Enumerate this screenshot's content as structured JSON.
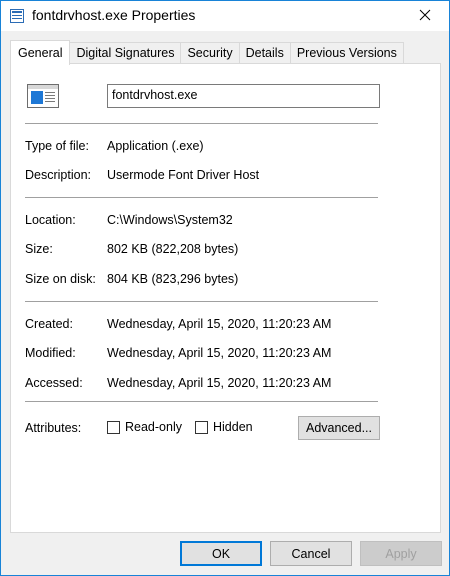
{
  "window": {
    "title": "fontdrvhost.exe Properties",
    "accent_color": "#1883d7"
  },
  "tabs": [
    {
      "label": "General",
      "active": true
    },
    {
      "label": "Digital Signatures",
      "active": false
    },
    {
      "label": "Security",
      "active": false
    },
    {
      "label": "Details",
      "active": false
    },
    {
      "label": "Previous Versions",
      "active": false
    }
  ],
  "general": {
    "file_icon": "exe-window-icon",
    "file_name": "fontdrvhost.exe",
    "type_label": "Type of file:",
    "type_value": "Application (.exe)",
    "description_label": "Description:",
    "description_value": "Usermode Font Driver Host",
    "location_label": "Location:",
    "location_value": "C:\\Windows\\System32",
    "size_label": "Size:",
    "size_value": "802 KB (822,208 bytes)",
    "size_on_disk_label": "Size on disk:",
    "size_on_disk_value": "804 KB (823,296 bytes)",
    "created_label": "Created:",
    "created_value": "Wednesday, April 15, 2020, 11:20:23 AM",
    "modified_label": "Modified:",
    "modified_value": "Wednesday, April 15, 2020, 11:20:23 AM",
    "accessed_label": "Accessed:",
    "accessed_value": "Wednesday, April 15, 2020, 11:20:23 AM",
    "attributes_label": "Attributes:",
    "readonly_label": "Read-only",
    "readonly_checked": false,
    "hidden_label": "Hidden",
    "hidden_checked": false,
    "advanced_label": "Advanced..."
  },
  "buttons": {
    "ok": "OK",
    "cancel": "Cancel",
    "apply": "Apply"
  }
}
